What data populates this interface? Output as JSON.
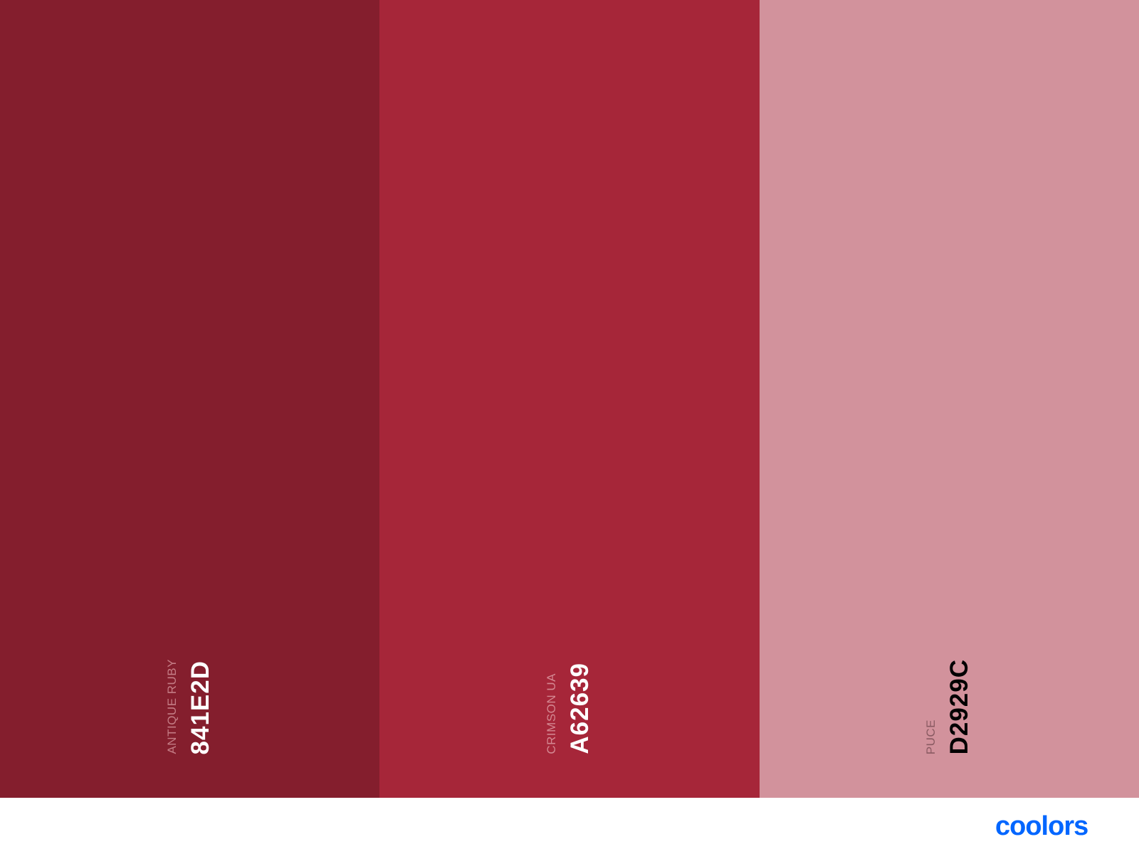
{
  "palette": {
    "swatches": [
      {
        "name": "ANTIQUE RUBY",
        "hex": "841E2D",
        "color": "#841E2D",
        "name_color": "#C47C85",
        "hex_color": "#FFFFFF"
      },
      {
        "name": "CRIMSON UA",
        "hex": "A62639",
        "color": "#A62639",
        "name_color": "#D48791",
        "hex_color": "#FFFFFF"
      },
      {
        "name": "PUCE",
        "hex": "D2929C",
        "color": "#D2929C",
        "name_color": "#8A5A62",
        "hex_color": "#000000"
      }
    ]
  },
  "footer": {
    "logo_text": "coolors",
    "logo_color": "#0066FF",
    "logo_icon": "coolors-logo"
  }
}
